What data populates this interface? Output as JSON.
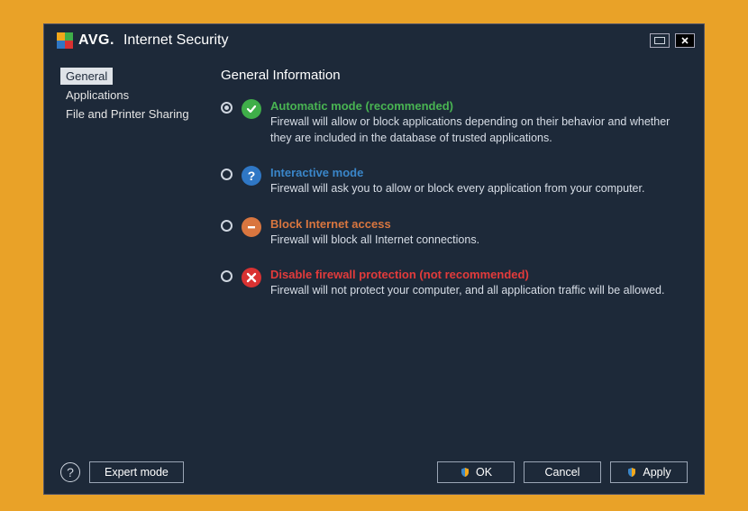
{
  "titlebar": {
    "logo_bold": "AVG.",
    "logo_thin": "Internet Security"
  },
  "sidebar": {
    "items": [
      {
        "label": "General",
        "selected": true
      },
      {
        "label": "Applications",
        "selected": false
      },
      {
        "label": "File and Printer Sharing",
        "selected": false
      }
    ]
  },
  "main": {
    "title": "General Information",
    "options": [
      {
        "id": "automatic",
        "selected": true,
        "icon": "check",
        "title": "Automatic mode (recommended)",
        "desc": "Firewall will allow or block applications depending on their behavior and whether they are included in the database of trusted applications."
      },
      {
        "id": "interactive",
        "selected": false,
        "icon": "question",
        "title": "Interactive mode",
        "desc": "Firewall will ask you to allow or block every application from your computer."
      },
      {
        "id": "block",
        "selected": false,
        "icon": "minus",
        "title": "Block Internet access",
        "desc": "Firewall will block all Internet connections."
      },
      {
        "id": "disable",
        "selected": false,
        "icon": "cross",
        "title": "Disable firewall protection (not recommended)",
        "desc": "Firewall will not protect your computer, and all application traffic will be allowed."
      }
    ]
  },
  "footer": {
    "expert": "Expert mode",
    "ok": "OK",
    "cancel": "Cancel",
    "apply": "Apply"
  }
}
